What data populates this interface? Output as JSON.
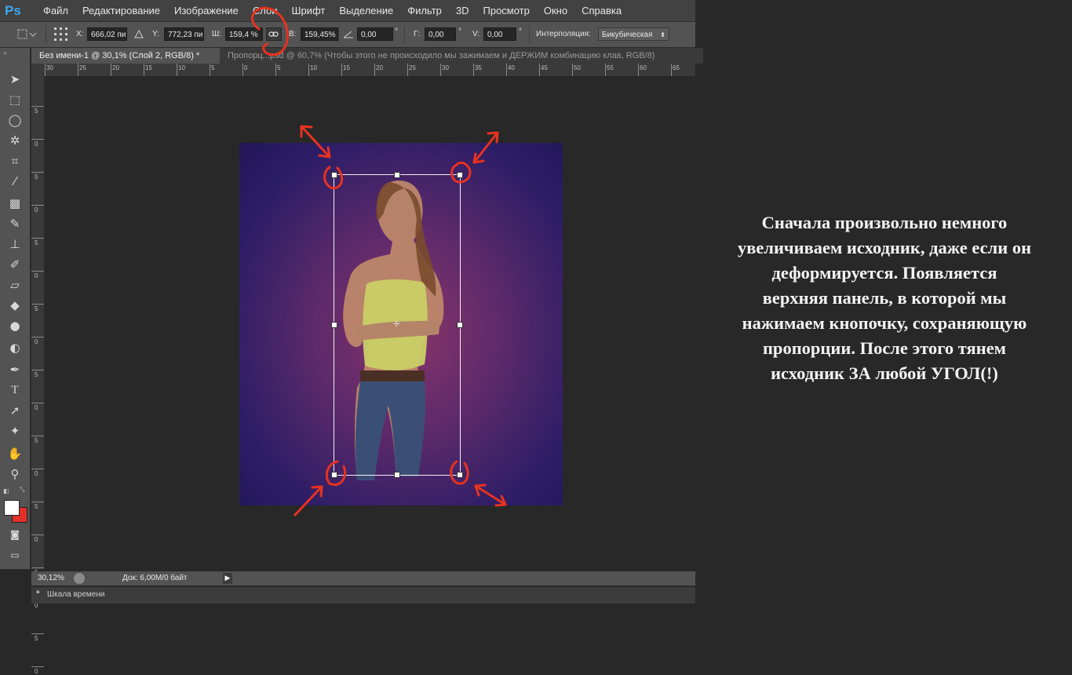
{
  "app": {
    "logo": "Ps"
  },
  "menu": [
    "Файл",
    "Редактирование",
    "Изображение",
    "Слои",
    "Шрифт",
    "Выделение",
    "Фильтр",
    "3D",
    "Просмотр",
    "Окно",
    "Справка"
  ],
  "options": {
    "x_label": "X:",
    "x_value": "666,02 пи",
    "y_label": "Y:",
    "y_value": "772,23 пи",
    "w_label": "Ш:",
    "w_value": "159,4  %",
    "h_label": "В:",
    "h_value": "159,45%",
    "angle_value": "0,00",
    "degree": "°",
    "g_label": "Г:",
    "g_value": "0,00",
    "v_label": "V:",
    "v_value": "0,00",
    "interp_label": "Интерполяция:",
    "interp_value": "Бикубическая"
  },
  "tabs": [
    {
      "label": "Без имени-1 @ 30,1% (Слой 2, RGB/8) *"
    },
    {
      "label": "Пропорц...psd @ 60,7% (Чтобы этого не происходило мы зажимаем и ДЕРЖИМ комбинацию клав, RGB/8)"
    }
  ],
  "ruler_h": [
    "30",
    "25",
    "20",
    "15",
    "10",
    "5",
    "0",
    "5",
    "10",
    "15",
    "20",
    "25",
    "30",
    "35",
    "40",
    "45",
    "50",
    "55",
    "60",
    "65"
  ],
  "ruler_v": [
    "5",
    "0",
    "5",
    "0",
    "5",
    "0",
    "5",
    "0",
    "5",
    "0",
    "5",
    "0",
    "5",
    "0",
    "5",
    "0",
    "5",
    "0"
  ],
  "status": {
    "zoom": "30,12%",
    "doc": "Док: 6,00M/0 байт"
  },
  "timeline": {
    "label": "Шкала времени"
  },
  "explanation": [
    "Сначала произвольно немного",
    "увеличиваем исходник, даже если он",
    "деформируется. Появляется",
    "верхняя панель, в которой мы",
    "нажимаем кнопочку, сохраняющую",
    "пропорции. После этого тянем",
    "исходник ЗА любой УГОЛ(!)"
  ],
  "colors": {
    "annotation": "#e8321f",
    "background": "#282828",
    "panel": "#535353",
    "foreground_swatch": "#ffffff",
    "background_swatch": "#e03028"
  },
  "icons": [
    "move-icon",
    "marquee-icon",
    "lasso-icon",
    "magic-wand-icon",
    "crop-icon",
    "eyedropper-icon",
    "healing-brush-icon",
    "brush-icon",
    "clone-stamp-icon",
    "history-brush-icon",
    "eraser-icon",
    "paint-bucket-icon",
    "blur-icon",
    "dodge-icon",
    "pen-icon",
    "type-icon",
    "path-selection-icon",
    "shape-icon",
    "hand-icon",
    "zoom-icon",
    "link-icon"
  ]
}
